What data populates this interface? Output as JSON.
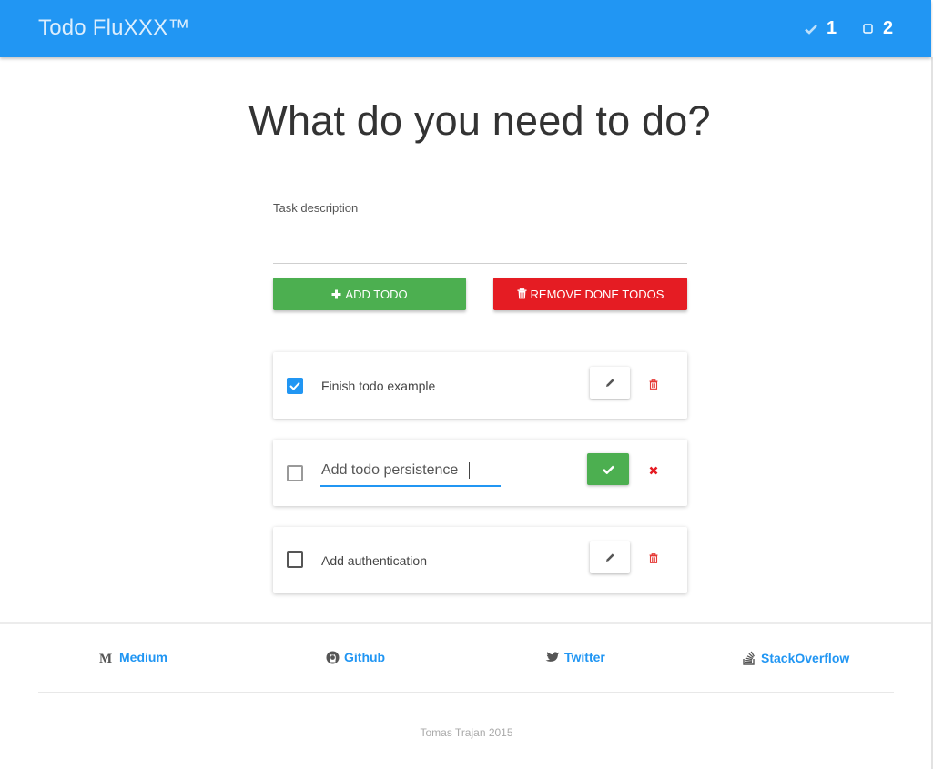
{
  "navbar": {
    "brand": "Todo FluXXX™",
    "done_count": "1",
    "todo_count": "2",
    "color": "#2196f3"
  },
  "main": {
    "headline": "What do you need to do?",
    "input_label": "Task description",
    "input_value": "",
    "add_button": {
      "label": "ADD TODO",
      "icon": "plus-icon",
      "color": "#4caf50"
    },
    "remove_button": {
      "label": "REMOVE DONE TODOS",
      "icon": "trash-icon",
      "color": "#e51c23"
    }
  },
  "todos": [
    {
      "text": "Finish todo example",
      "done": true,
      "editing": false,
      "actions": [
        "pencil-icon",
        "trash-icon"
      ]
    },
    {
      "text": "Add todo persistence",
      "done": false,
      "editing": true,
      "actions": [
        "check-icon",
        "close-icon"
      ]
    },
    {
      "text": "Add authentication",
      "done": false,
      "editing": false,
      "actions": [
        "pencil-icon",
        "trash-icon"
      ]
    }
  ],
  "footer": {
    "links": [
      {
        "label": "Medium",
        "icon": "medium-icon"
      },
      {
        "label": "Github",
        "icon": "github-icon"
      },
      {
        "label": "Twitter",
        "icon": "twitter-icon"
      },
      {
        "label": "StackOverflow",
        "icon": "stackoverflow-icon"
      }
    ],
    "copyright": "Tomas Trajan 2015",
    "link_color": "#2196f3"
  }
}
